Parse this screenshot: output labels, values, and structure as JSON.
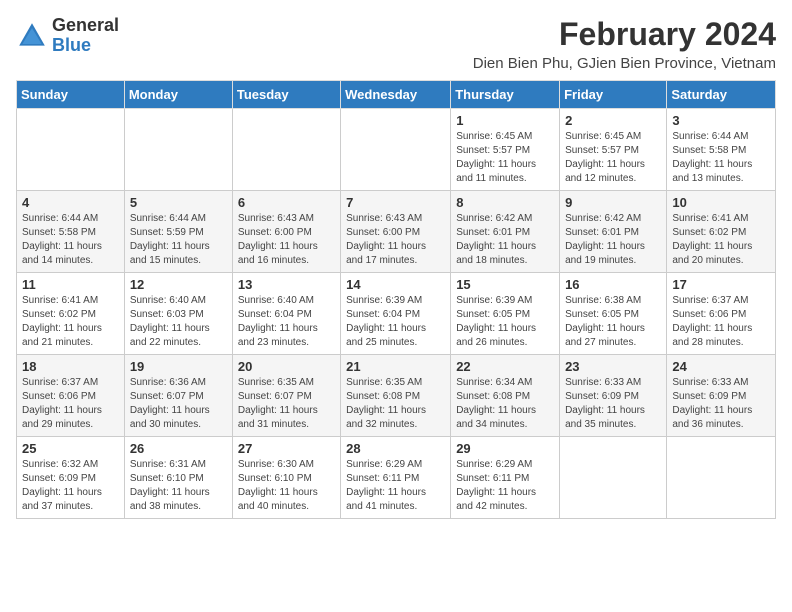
{
  "header": {
    "logo_general": "General",
    "logo_blue": "Blue",
    "month_year": "February 2024",
    "location": "Dien Bien Phu, GJien Bien Province, Vietnam"
  },
  "weekdays": [
    "Sunday",
    "Monday",
    "Tuesday",
    "Wednesday",
    "Thursday",
    "Friday",
    "Saturday"
  ],
  "weeks": [
    [
      {
        "day": "",
        "info": ""
      },
      {
        "day": "",
        "info": ""
      },
      {
        "day": "",
        "info": ""
      },
      {
        "day": "",
        "info": ""
      },
      {
        "day": "1",
        "info": "Sunrise: 6:45 AM\nSunset: 5:57 PM\nDaylight: 11 hours and 11 minutes."
      },
      {
        "day": "2",
        "info": "Sunrise: 6:45 AM\nSunset: 5:57 PM\nDaylight: 11 hours and 12 minutes."
      },
      {
        "day": "3",
        "info": "Sunrise: 6:44 AM\nSunset: 5:58 PM\nDaylight: 11 hours and 13 minutes."
      }
    ],
    [
      {
        "day": "4",
        "info": "Sunrise: 6:44 AM\nSunset: 5:58 PM\nDaylight: 11 hours and 14 minutes."
      },
      {
        "day": "5",
        "info": "Sunrise: 6:44 AM\nSunset: 5:59 PM\nDaylight: 11 hours and 15 minutes."
      },
      {
        "day": "6",
        "info": "Sunrise: 6:43 AM\nSunset: 6:00 PM\nDaylight: 11 hours and 16 minutes."
      },
      {
        "day": "7",
        "info": "Sunrise: 6:43 AM\nSunset: 6:00 PM\nDaylight: 11 hours and 17 minutes."
      },
      {
        "day": "8",
        "info": "Sunrise: 6:42 AM\nSunset: 6:01 PM\nDaylight: 11 hours and 18 minutes."
      },
      {
        "day": "9",
        "info": "Sunrise: 6:42 AM\nSunset: 6:01 PM\nDaylight: 11 hours and 19 minutes."
      },
      {
        "day": "10",
        "info": "Sunrise: 6:41 AM\nSunset: 6:02 PM\nDaylight: 11 hours and 20 minutes."
      }
    ],
    [
      {
        "day": "11",
        "info": "Sunrise: 6:41 AM\nSunset: 6:02 PM\nDaylight: 11 hours and 21 minutes."
      },
      {
        "day": "12",
        "info": "Sunrise: 6:40 AM\nSunset: 6:03 PM\nDaylight: 11 hours and 22 minutes."
      },
      {
        "day": "13",
        "info": "Sunrise: 6:40 AM\nSunset: 6:04 PM\nDaylight: 11 hours and 23 minutes."
      },
      {
        "day": "14",
        "info": "Sunrise: 6:39 AM\nSunset: 6:04 PM\nDaylight: 11 hours and 25 minutes."
      },
      {
        "day": "15",
        "info": "Sunrise: 6:39 AM\nSunset: 6:05 PM\nDaylight: 11 hours and 26 minutes."
      },
      {
        "day": "16",
        "info": "Sunrise: 6:38 AM\nSunset: 6:05 PM\nDaylight: 11 hours and 27 minutes."
      },
      {
        "day": "17",
        "info": "Sunrise: 6:37 AM\nSunset: 6:06 PM\nDaylight: 11 hours and 28 minutes."
      }
    ],
    [
      {
        "day": "18",
        "info": "Sunrise: 6:37 AM\nSunset: 6:06 PM\nDaylight: 11 hours and 29 minutes."
      },
      {
        "day": "19",
        "info": "Sunrise: 6:36 AM\nSunset: 6:07 PM\nDaylight: 11 hours and 30 minutes."
      },
      {
        "day": "20",
        "info": "Sunrise: 6:35 AM\nSunset: 6:07 PM\nDaylight: 11 hours and 31 minutes."
      },
      {
        "day": "21",
        "info": "Sunrise: 6:35 AM\nSunset: 6:08 PM\nDaylight: 11 hours and 32 minutes."
      },
      {
        "day": "22",
        "info": "Sunrise: 6:34 AM\nSunset: 6:08 PM\nDaylight: 11 hours and 34 minutes."
      },
      {
        "day": "23",
        "info": "Sunrise: 6:33 AM\nSunset: 6:09 PM\nDaylight: 11 hours and 35 minutes."
      },
      {
        "day": "24",
        "info": "Sunrise: 6:33 AM\nSunset: 6:09 PM\nDaylight: 11 hours and 36 minutes."
      }
    ],
    [
      {
        "day": "25",
        "info": "Sunrise: 6:32 AM\nSunset: 6:09 PM\nDaylight: 11 hours and 37 minutes."
      },
      {
        "day": "26",
        "info": "Sunrise: 6:31 AM\nSunset: 6:10 PM\nDaylight: 11 hours and 38 minutes."
      },
      {
        "day": "27",
        "info": "Sunrise: 6:30 AM\nSunset: 6:10 PM\nDaylight: 11 hours and 40 minutes."
      },
      {
        "day": "28",
        "info": "Sunrise: 6:29 AM\nSunset: 6:11 PM\nDaylight: 11 hours and 41 minutes."
      },
      {
        "day": "29",
        "info": "Sunrise: 6:29 AM\nSunset: 6:11 PM\nDaylight: 11 hours and 42 minutes."
      },
      {
        "day": "",
        "info": ""
      },
      {
        "day": "",
        "info": ""
      }
    ]
  ]
}
